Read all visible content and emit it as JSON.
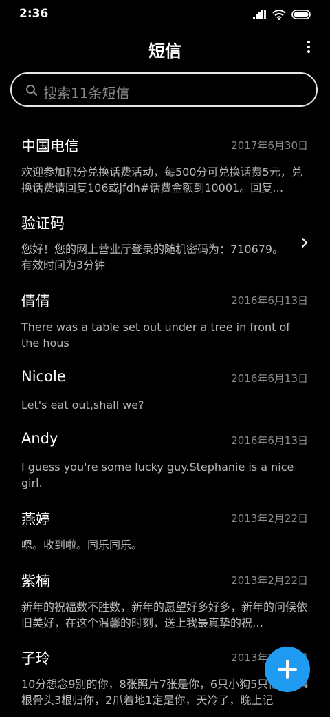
{
  "status_bar": {
    "time": "2:36"
  },
  "header": {
    "title": "短信"
  },
  "search": {
    "placeholder": "搜索11条短信"
  },
  "messages": [
    {
      "name": "中国电信",
      "date": "2017年6月30日",
      "preview": "欢迎参加积分兑换话费活动，每500分可兑换话费5元，兑换话费请回复106或jfdh#话费金额到10001。回复…"
    },
    {
      "name": "验证码",
      "date": "",
      "preview": "您好！您的网上营业厅登录的随机密码为：710679。有效时间为3分钟"
    },
    {
      "name": "倩倩",
      "date": "2016年6月13日",
      "preview": "There was a table set out under a tree in front of the hous"
    },
    {
      "name": "Nicole",
      "date": "2016年6月13日",
      "preview": "Let's eat out,shall we?"
    },
    {
      "name": "Andy",
      "date": "2016年6月13日",
      "preview": "I guess you're some lucky guy.Stephanie is a nice girl."
    },
    {
      "name": "燕婷",
      "date": "2013年2月22日",
      "preview": "嗯。收到啦。同乐同乐。"
    },
    {
      "name": "紫楠",
      "date": "2013年2月22日",
      "preview": "新年的祝福数不胜数，新年的愿望好多好多，新年的问候依旧美好，在这个温馨的时刻，送上我最真挚的祝…"
    },
    {
      "name": "子玲",
      "date": "2013年2月22日",
      "preview": "10分想念9别的你，8张照片7张是你，6只小狗5只像你，4根骨头3根归你，2爪着地1定是你，天冷了，晚上记"
    }
  ],
  "colors": {
    "accent": "#1f9cf2",
    "background": "#000000",
    "secondary_text": "#8c8c8c"
  },
  "icons": [
    "cellular-signal-icon",
    "wifi-icon",
    "battery-icon",
    "more-vertical-icon",
    "search-icon",
    "chevron-right-icon",
    "plus-icon"
  ]
}
